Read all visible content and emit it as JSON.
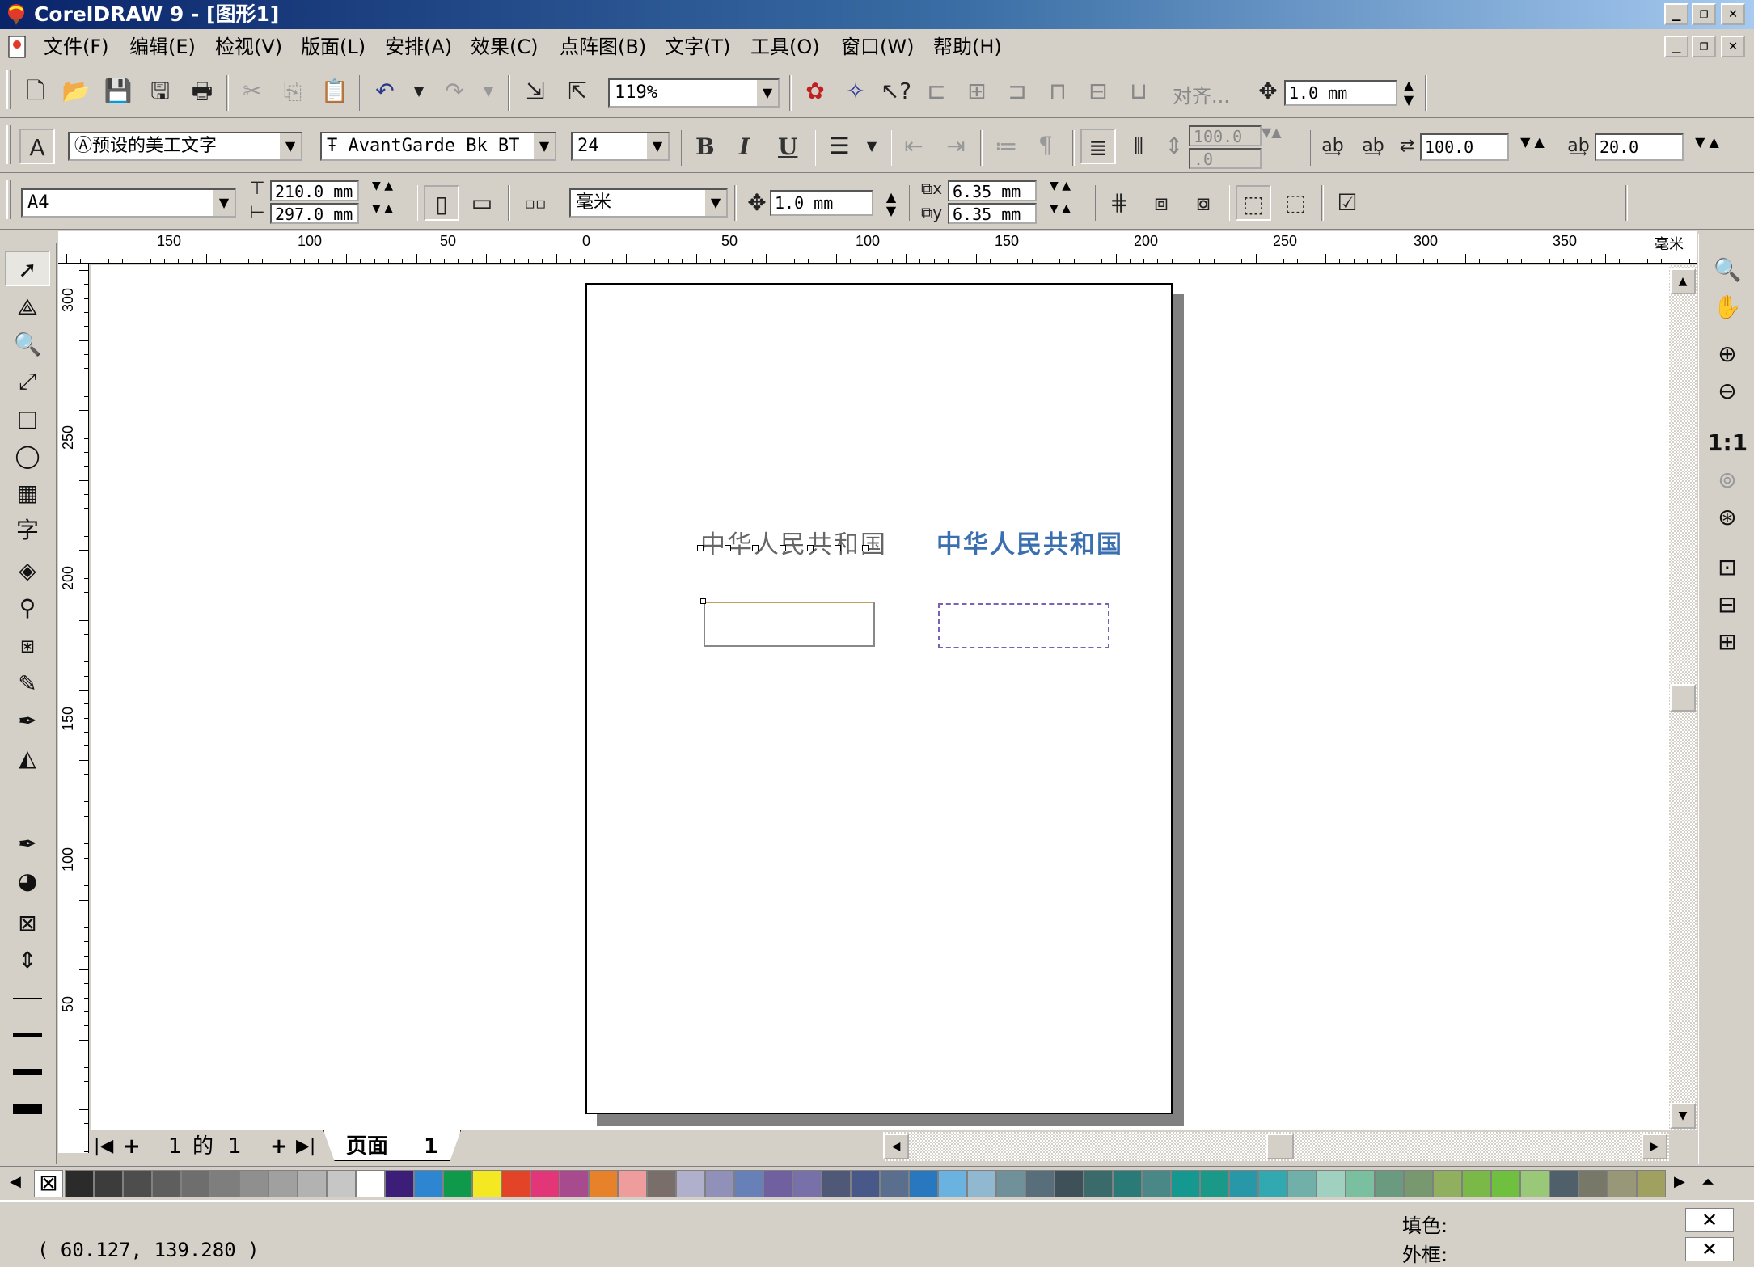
{
  "window": {
    "title": "CorelDRAW 9 - [图形1]"
  },
  "menu": [
    "文件(F)",
    "编辑(E)",
    "检视(V)",
    "版面(L)",
    "安排(A)",
    "效果(C)",
    "点阵图(B)",
    "文字(T)",
    "工具(O)",
    "窗口(W)",
    "帮助(H)"
  ],
  "standard_toolbar": {
    "zoom": "119%",
    "snap_label": "对齐...",
    "nudge": "1.0 mm"
  },
  "text_toolbar": {
    "style": "预设的美工文字",
    "font": "AvantGarde Bk BT",
    "size": "24",
    "bold": "B",
    "italic": "I",
    "underline": "U",
    "paragraph": "¶",
    "char_spacing_1": "100.0",
    "char_spacing_2": ".0",
    "word_spacing": "100.0",
    "line_spacing": "20.0"
  },
  "property_bar": {
    "paper": "A4",
    "width": "210.0 mm",
    "height": "297.0 mm",
    "units": "毫米",
    "nudge": "1.0 mm",
    "dup_x": "6.35 mm",
    "dup_y": "6.35 mm"
  },
  "ruler": {
    "unit": "毫米",
    "h_labels": [
      "150",
      "100",
      "50",
      "0",
      "50",
      "100",
      "150",
      "200",
      "250",
      "300",
      "350"
    ],
    "v_labels": [
      "300",
      "250",
      "200",
      "150",
      "100",
      "50"
    ]
  },
  "document": {
    "text_plain": "中华人民共和国",
    "text_styled": "中华人民共和国"
  },
  "page_nav": {
    "first": "|◀",
    "add_before": "+",
    "counter_num": "1",
    "counter_of": "的",
    "counter_total": "1",
    "add_after": "+",
    "last": "▶|",
    "tab_label": "页面",
    "tab_num": "1"
  },
  "palette": {
    "colors": [
      "#2b2b2b",
      "#3c3c3c",
      "#4d4d4d",
      "#5e5e5e",
      "#6e6e6e",
      "#7e7e7e",
      "#8f8f8f",
      "#a0a0a0",
      "#b2b2b2",
      "#c6c6c6",
      "#ffffff",
      "#3c1e78",
      "#2e86d0",
      "#0e9a4a",
      "#f4e823",
      "#e34327",
      "#e23678",
      "#a84a8e",
      "#e8822a",
      "#ee9c9c",
      "#7a6e6a",
      "#b0b0cc",
      "#9090b8",
      "#6880b8",
      "#7060a0",
      "#7870a8",
      "#505878",
      "#485888",
      "#5a6e8e",
      "#2878c0",
      "#6ab2e0",
      "#90b8d0",
      "#70909a",
      "#586e7a",
      "#3e5058",
      "#3a6a6a",
      "#2a7a78",
      "#4a8888",
      "#149890",
      "#1a9888",
      "#2898a8",
      "#32a8b0",
      "#70b0a8",
      "#a0d0c0",
      "#7ac0a0",
      "#6a9a80",
      "#789870",
      "#90b060",
      "#7ab848",
      "#70c040",
      "#98c878",
      "#50606a",
      "#787868",
      "#989878",
      "#a0a060"
    ]
  },
  "status": {
    "coords": "( 60.127, 139.280 )",
    "fill_label": "填色:",
    "outline_label": "外框:"
  }
}
